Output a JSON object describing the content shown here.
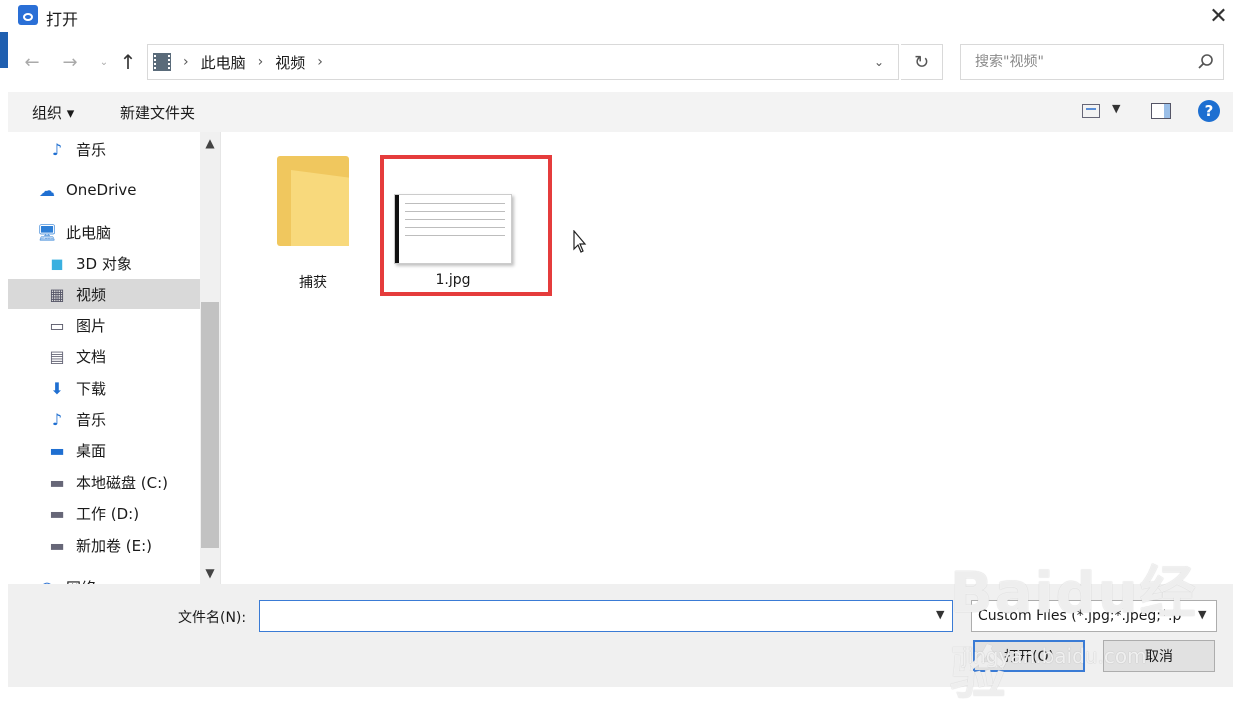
{
  "window": {
    "title": "打开",
    "close_label": "✕"
  },
  "nav_buttons": {
    "back": "←",
    "forward": "→",
    "recent": "⌄",
    "up": "↑"
  },
  "address": {
    "crumbs": [
      "此电脑",
      "视频"
    ],
    "sep": "›",
    "dropdown": "⌄",
    "refresh": "↻"
  },
  "search": {
    "placeholder": "搜索\"视频\""
  },
  "toolbar": {
    "organize": "组织 ▾",
    "new_folder": "新建文件夹",
    "view_dd": "▼",
    "help": "?"
  },
  "sidebar": {
    "items": [
      {
        "label": "音乐",
        "icon": "music-icon",
        "glyph": "♪"
      },
      {
        "label": "OneDrive",
        "icon": "cloud-icon",
        "glyph": "☁"
      },
      {
        "label": "此电脑",
        "icon": "computer-icon",
        "glyph": "🖥"
      },
      {
        "label": "3D 对象",
        "icon": "cube-icon",
        "glyph": "◼"
      },
      {
        "label": "视频",
        "icon": "film-icon",
        "glyph": "▦"
      },
      {
        "label": "图片",
        "icon": "picture-icon",
        "glyph": "▭"
      },
      {
        "label": "文档",
        "icon": "document-icon",
        "glyph": "▤"
      },
      {
        "label": "下载",
        "icon": "download-icon",
        "glyph": "⬇"
      },
      {
        "label": "音乐",
        "icon": "music-icon",
        "glyph": "♪"
      },
      {
        "label": "桌面",
        "icon": "desktop-icon",
        "glyph": "▬"
      },
      {
        "label": "本地磁盘 (C:)",
        "icon": "drive-icon",
        "glyph": "▬"
      },
      {
        "label": "工作 (D:)",
        "icon": "drive-icon",
        "glyph": "▬"
      },
      {
        "label": "新加卷 (E:)",
        "icon": "drive-icon",
        "glyph": "▬"
      },
      {
        "label": "网络",
        "icon": "network-icon",
        "glyph": "◍"
      }
    ],
    "selected": "视频",
    "scroll_up": "▲",
    "scroll_down": "▼"
  },
  "files": [
    {
      "name": "捕获",
      "type": "folder"
    },
    {
      "name": "1.jpg",
      "type": "image"
    }
  ],
  "bottom": {
    "filename_label": "文件名(N):",
    "filename_value": "",
    "filename_dd": "▼",
    "filetype": "Custom Files (*.jpg;*.jpeg;*.p",
    "filetype_dd": "▼",
    "open": "打开(O)",
    "cancel": "取消"
  },
  "watermark": {
    "brand": "Baidu经验",
    "url": "jingyan.baidu.com"
  },
  "colors": {
    "accent": "#3a7bd5",
    "highlight": "#e53c3c",
    "folder": "#f0c75e"
  }
}
